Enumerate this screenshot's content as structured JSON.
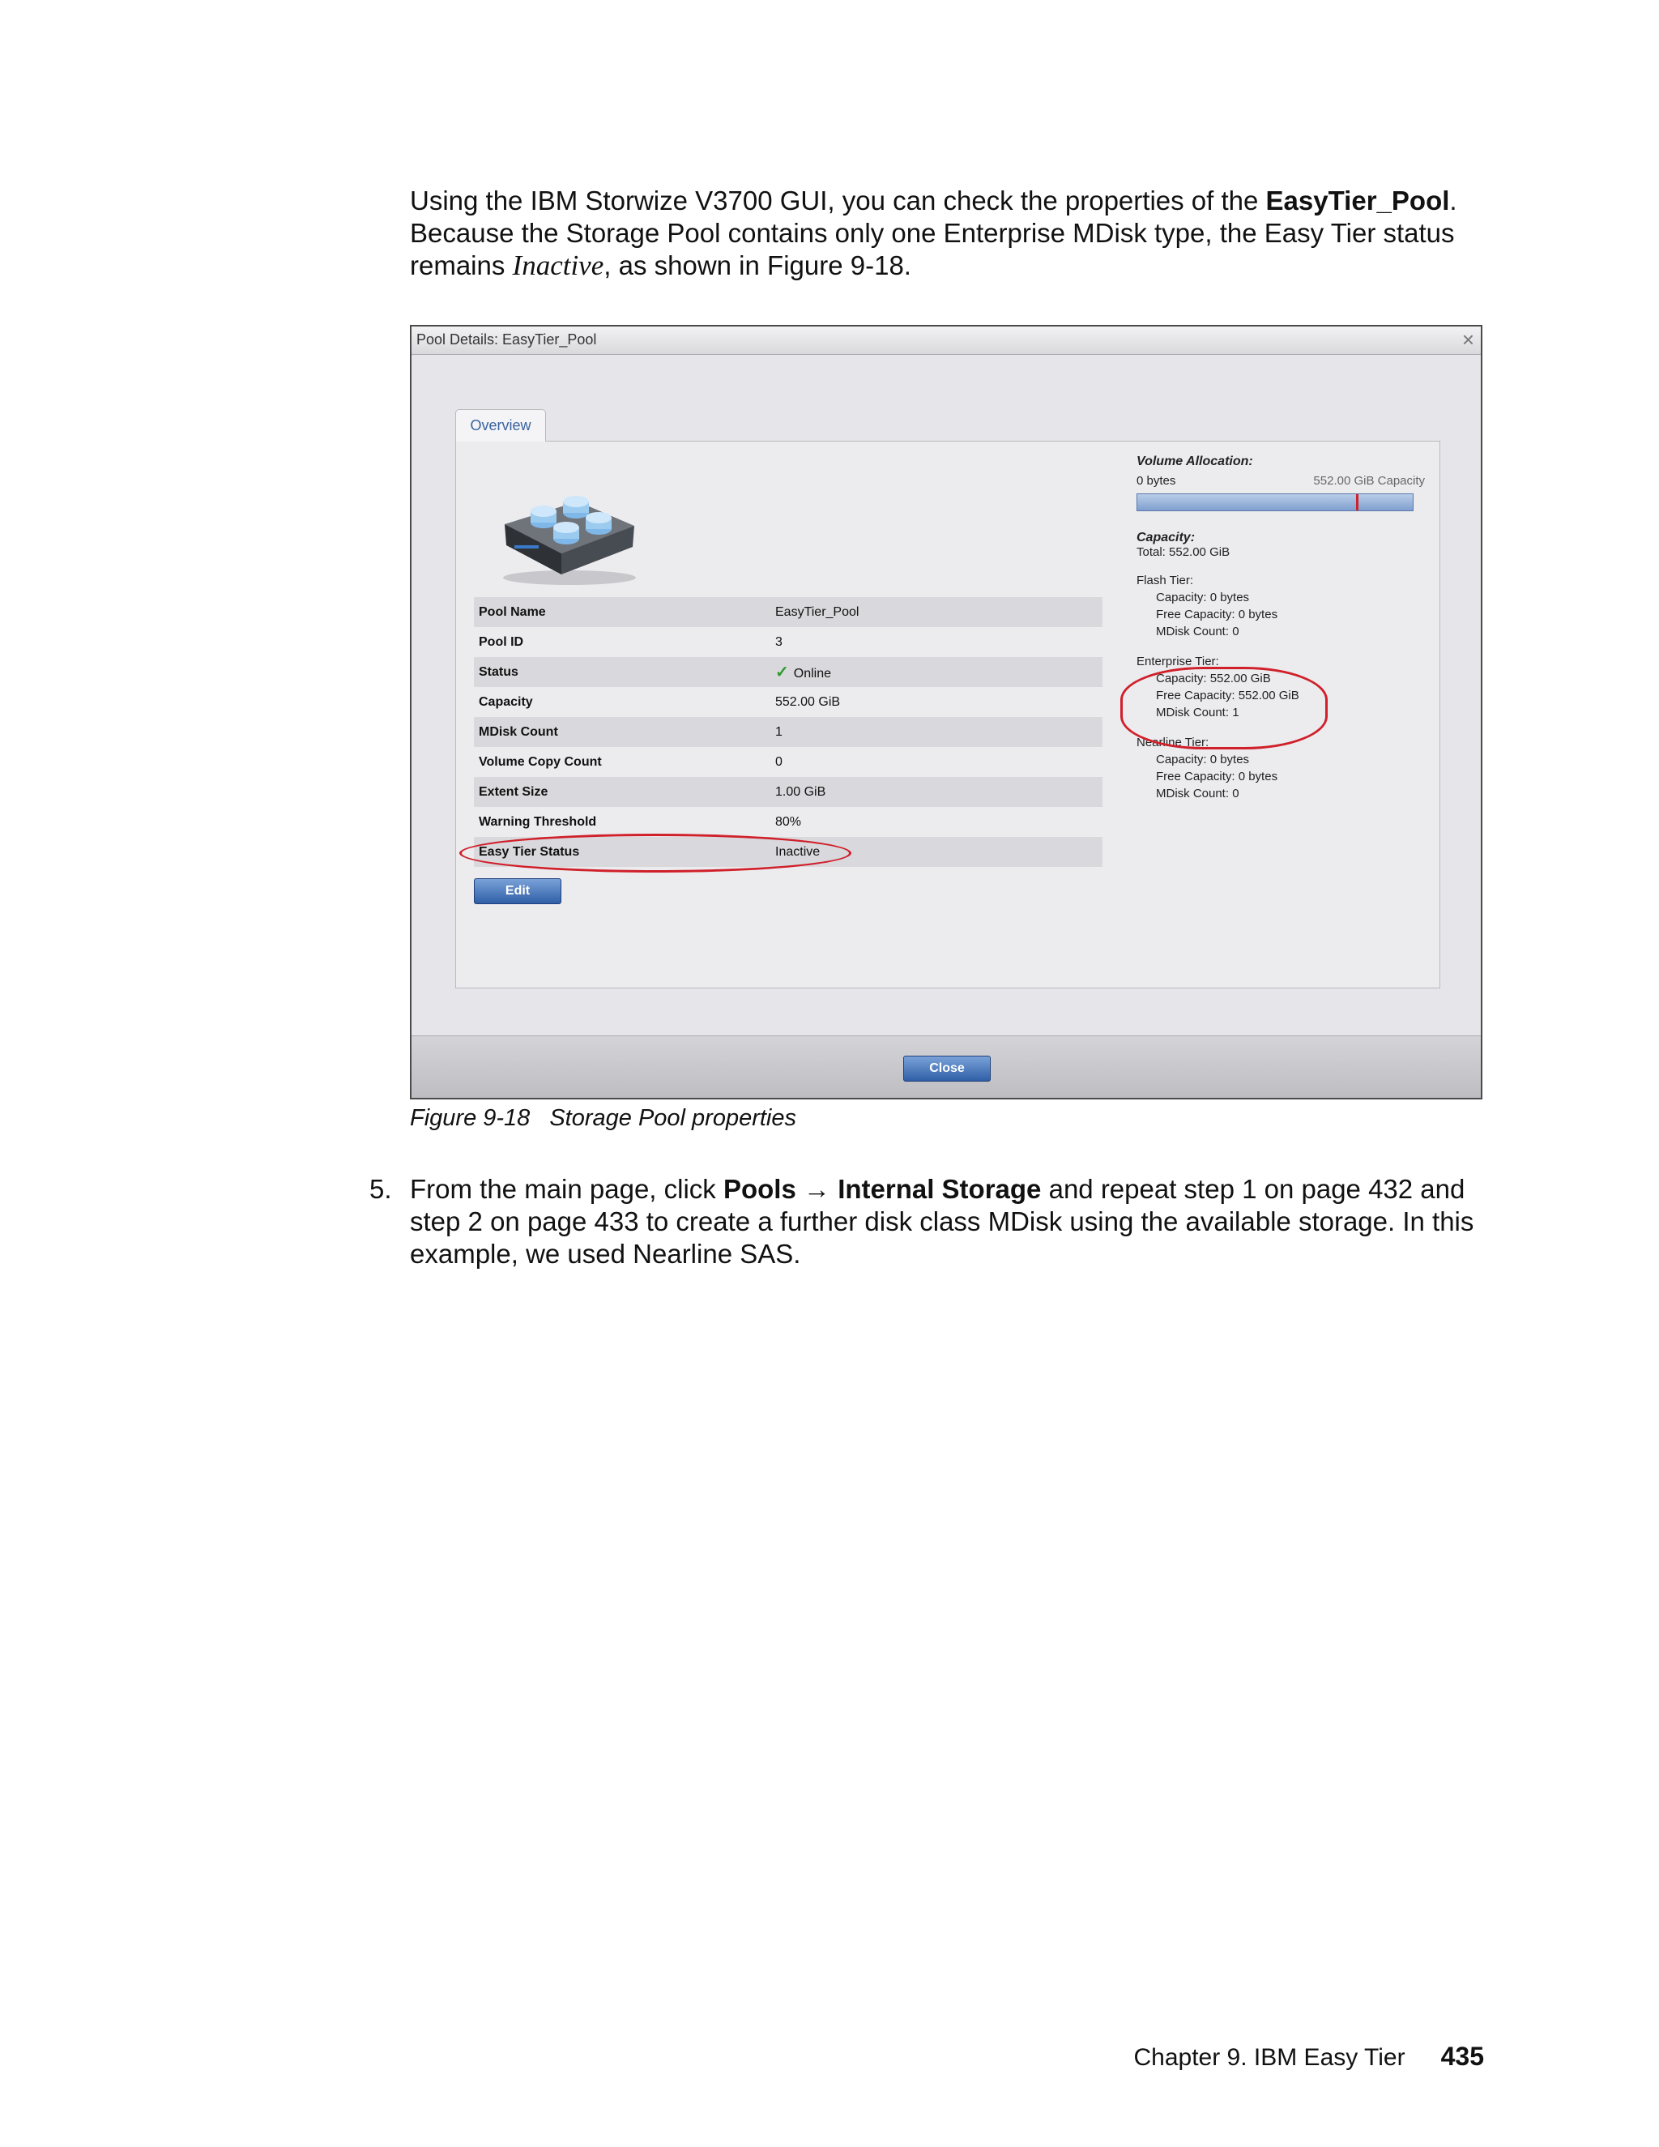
{
  "intro": {
    "t1": "Using the IBM Storwize V3700 GUI, you can check the properties of the ",
    "pool_bold": "EasyTier_Pool",
    "t2": ". Because the Storage Pool contains only one Enterprise MDisk type, the Easy Tier status remains ",
    "status_italic": "Inactive",
    "t3": ", as shown in Figure 9-18."
  },
  "dialog": {
    "title": "Pool Details: EasyTier_Pool",
    "close_glyph": "×",
    "tab": "Overview",
    "properties": [
      {
        "key": "Pool Name",
        "value": "EasyTier_Pool"
      },
      {
        "key": "Pool ID",
        "value": "3"
      },
      {
        "key": "Status",
        "value": "Online"
      },
      {
        "key": "Capacity",
        "value": "552.00 GiB"
      },
      {
        "key": "MDisk Count",
        "value": "1"
      },
      {
        "key": "Volume Copy Count",
        "value": "0"
      },
      {
        "key": "Extent Size",
        "value": "1.00 GiB"
      },
      {
        "key": "Warning Threshold",
        "value": "80%"
      },
      {
        "key": "Easy Tier Status",
        "value": "Inactive"
      }
    ],
    "status_icon": "check-icon",
    "edit_label": "Edit",
    "volume_allocation": {
      "header": "Volume Allocation:",
      "left_label": "0 bytes",
      "right_label": "552.00 GiB Capacity",
      "marker_fraction": 0.8
    },
    "capacity": {
      "header": "Capacity:",
      "total": "Total: 552.00 GiB"
    },
    "tiers": [
      {
        "name": "Flash Tier:",
        "capacity": "Capacity: 0 bytes",
        "free": "Free Capacity: 0 bytes",
        "mdisks": "MDisk Count: 0"
      },
      {
        "name": "Enterprise Tier:",
        "capacity": "Capacity: 552.00 GiB",
        "free": "Free Capacity: 552.00 GiB",
        "mdisks": "MDisk Count: 1"
      },
      {
        "name": "Nearline Tier:",
        "capacity": "Capacity: 0 bytes",
        "free": "Free Capacity: 0 bytes",
        "mdisks": "MDisk Count: 0"
      }
    ],
    "close_label": "Close",
    "highlight_color": "#d0202a"
  },
  "caption": {
    "figure": "Figure 9-18",
    "text": "Storage Pool properties"
  },
  "step": {
    "num": "5.",
    "t1": "From the main page, click ",
    "b1": "Pools",
    "arrow": " → ",
    "b2": "Internal Storage",
    "t2": " and repeat step 1 on page 432 and step 2 on page 433 to create a further disk class MDisk using the available storage. In this example, we used Nearline SAS."
  },
  "footer": {
    "chapter": "Chapter 9. IBM Easy Tier",
    "page": "435"
  }
}
